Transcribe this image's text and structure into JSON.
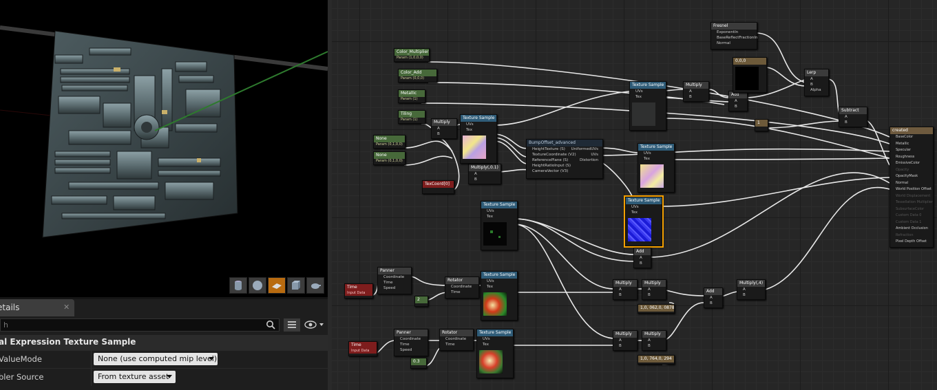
{
  "viewport": {
    "toolbar": [
      {
        "name": "cylinder-icon"
      },
      {
        "name": "sphere-icon"
      },
      {
        "name": "plane-icon",
        "active": true
      },
      {
        "name": "cube-icon"
      },
      {
        "name": "teapot-icon"
      }
    ],
    "accent_active": "#b86b10"
  },
  "details": {
    "tab_label": "etails",
    "close_label": "✕",
    "search_placeholder": "h",
    "section_title": "rial Expression Texture Sample",
    "rows": [
      {
        "label": "ValueMode",
        "value": "None (use computed mip level)"
      },
      {
        "label": "bler Source",
        "value": "From texture asset"
      }
    ]
  },
  "graph": {
    "nodes": [
      {
        "id": "color_mult",
        "title": "Color_Multiplier",
        "sub": "Param (1,0,0,0)",
        "kind": "gr"
      },
      {
        "id": "color_add",
        "title": "Color_Add",
        "sub": "Param (0,0,0)",
        "kind": "gr"
      },
      {
        "id": "metallic",
        "title": "Metallic",
        "sub": "Param (1)",
        "kind": "gr"
      },
      {
        "id": "tiling",
        "title": "Tiling",
        "sub": "Param (1)",
        "kind": "gr"
      },
      {
        "id": "none1",
        "title": "None",
        "sub": "Param (0,1,0,0)",
        "kind": "gr"
      },
      {
        "id": "none2",
        "title": "None",
        "sub": "Param (0,1,0,0)",
        "kind": "gr"
      },
      {
        "id": "texcoord",
        "title": "TexCoord[0]",
        "kind": "r"
      },
      {
        "id": "multiply1",
        "title": "Multiply",
        "pins": [
          "A",
          "B"
        ],
        "kind": "g"
      },
      {
        "id": "multiply_01",
        "title": "Multiply(,0.1)",
        "pins": [
          "A",
          "B"
        ],
        "kind": "g"
      },
      {
        "id": "tex1",
        "title": "Texture Sample",
        "pins": [
          "UVs",
          "Tex"
        ],
        "kind": "b"
      },
      {
        "id": "bump",
        "title": "BumpOffset_advanced",
        "pins": [
          "HeightTexture (S)",
          "TextureCoordinate (V2)",
          "ReferencePlane (S)",
          "HeightRatioInput (S)",
          "CameraVector (V3)"
        ],
        "outs": [
          "UniformedUVs",
          "UVs",
          "Distortion"
        ],
        "kind": "d"
      },
      {
        "id": "tex_top",
        "title": "Texture Sample",
        "pins": [
          "UVs",
          "Tex"
        ],
        "kind": "b"
      },
      {
        "id": "multiply_top",
        "title": "Multiply",
        "pins": [
          "A",
          "B"
        ],
        "kind": "g"
      },
      {
        "id": "add_top",
        "title": "Add",
        "pins": [
          "A",
          "B"
        ],
        "kind": "g"
      },
      {
        "id": "fresnel",
        "title": "Fresnel",
        "pins": [
          "ExponentIn",
          "BaseReflectFractionIn",
          "Normal"
        ],
        "kind": "g"
      },
      {
        "id": "const000",
        "title": "0,0,0",
        "kind": "t"
      },
      {
        "id": "lerp",
        "title": "Lerp",
        "pins": [
          "A",
          "B",
          "Alpha"
        ],
        "kind": "g"
      },
      {
        "id": "subtract",
        "title": "Subtract",
        "pins": [
          "A",
          "B"
        ],
        "kind": "g"
      },
      {
        "id": "const1",
        "title": "1",
        "kind": "t"
      },
      {
        "id": "tex_mid",
        "title": "Texture Sample",
        "pins": [
          "UVs",
          "Tex"
        ],
        "kind": "b"
      },
      {
        "id": "tex_normal",
        "title": "Texture Sample",
        "pins": [
          "UVs",
          "Tex"
        ],
        "kind": "b"
      },
      {
        "id": "tex_mask",
        "title": "Texture Sample",
        "pins": [
          "UVs",
          "Tex"
        ],
        "kind": "b"
      },
      {
        "id": "add_mid",
        "title": "Add",
        "pins": [
          "A",
          "B"
        ],
        "kind": "g"
      },
      {
        "id": "time1",
        "title": "Time",
        "sub": "Input Data",
        "kind": "r"
      },
      {
        "id": "panner1",
        "title": "Panner",
        "pins": [
          "Coordinate",
          "Time",
          "Speed"
        ],
        "kind": "g"
      },
      {
        "id": "const2",
        "title": "2",
        "kind": "gr"
      },
      {
        "id": "rotator1",
        "title": "Rotator",
        "pins": [
          "Coordinate",
          "Time"
        ],
        "kind": "g"
      },
      {
        "id": "tex_fx1",
        "title": "Texture Sample",
        "pins": [
          "UVs",
          "Tex"
        ],
        "kind": "b"
      },
      {
        "id": "mult_a1",
        "title": "Multiply",
        "pins": [
          "A",
          "B"
        ],
        "kind": "g"
      },
      {
        "id": "mult_b1",
        "title": "Multiply",
        "pins": [
          "A",
          "B"
        ],
        "kind": "g"
      },
      {
        "id": "vec1",
        "title": "1,0, 062,0, 0878",
        "kind": "t"
      },
      {
        "id": "add_low",
        "title": "Add",
        "pins": [
          "A",
          "B"
        ],
        "kind": "g"
      },
      {
        "id": "multiply_4",
        "title": "Multiply(,4)",
        "pins": [
          "A",
          "B"
        ],
        "kind": "g"
      },
      {
        "id": "time2",
        "title": "Time",
        "sub": "Input Data",
        "kind": "r"
      },
      {
        "id": "panner2",
        "title": "Panner",
        "pins": [
          "Coordinate",
          "Time",
          "Speed"
        ],
        "kind": "g"
      },
      {
        "id": "const03",
        "title": "0.3",
        "kind": "gr"
      },
      {
        "id": "rotator2",
        "title": "Rotator",
        "pins": [
          "Coordinate",
          "Time"
        ],
        "kind": "g"
      },
      {
        "id": "tex_fx2",
        "title": "Texture Sample",
        "pins": [
          "UVs",
          "Tex"
        ],
        "kind": "b"
      },
      {
        "id": "mult_a2",
        "title": "Multiply",
        "pins": [
          "A",
          "B"
        ],
        "kind": "g"
      },
      {
        "id": "mult_b2",
        "title": "Multiply",
        "pins": [
          "A",
          "B"
        ],
        "kind": "g"
      },
      {
        "id": "vec2",
        "title": "1,0, 764,0, 294",
        "kind": "t"
      }
    ],
    "result": {
      "title": "created",
      "pins": [
        {
          "label": "BaseColor",
          "active": true
        },
        {
          "label": "Metallic",
          "active": true
        },
        {
          "label": "Specular",
          "active": true
        },
        {
          "label": "Roughness",
          "active": true
        },
        {
          "label": "EmissiveColor",
          "active": true
        },
        {
          "label": "Opacity",
          "active": false
        },
        {
          "label": "OpacityMask",
          "active": true
        },
        {
          "label": "Normal",
          "active": true
        },
        {
          "label": "World Position Offset",
          "active": true
        },
        {
          "label": "World Displacement",
          "active": false
        },
        {
          "label": "Tessellation Multiplier",
          "active": false
        },
        {
          "label": "SubsurfaceColor",
          "active": false
        },
        {
          "label": "Custom Data 0",
          "active": false
        },
        {
          "label": "Custom Data 1",
          "active": false
        },
        {
          "label": "Ambient Occlusion",
          "active": true
        },
        {
          "label": "Refraction",
          "active": false
        },
        {
          "label": "Pixel Depth Offset",
          "active": true
        }
      ]
    }
  }
}
